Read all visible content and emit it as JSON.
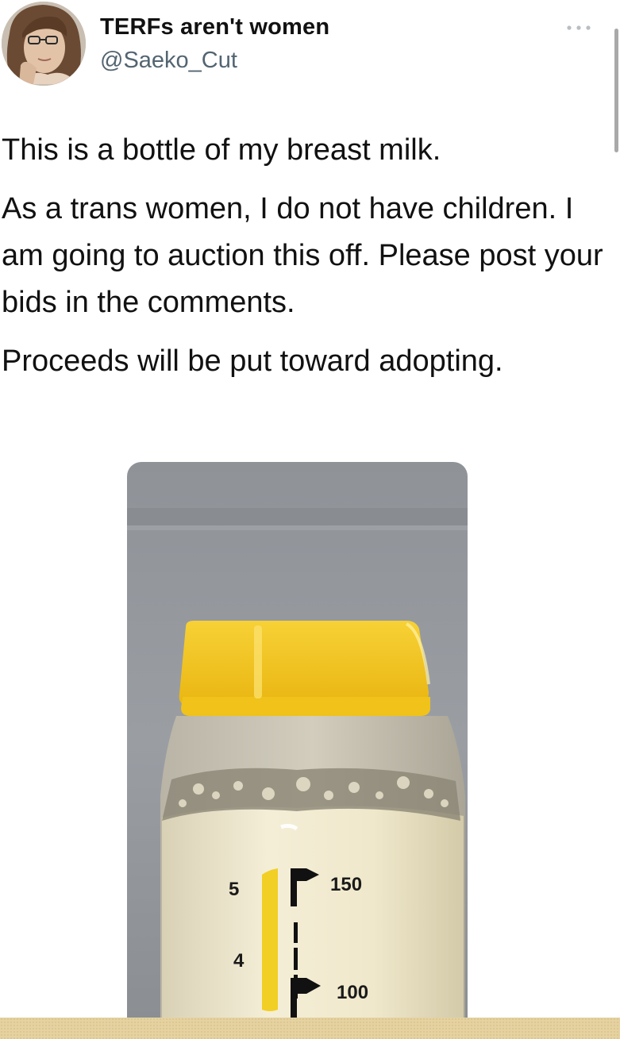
{
  "tweet": {
    "author": {
      "display_name": "TERFs aren't women",
      "handle": "@Saeko_Cut"
    },
    "menu_icon": "more-horizontal-icon",
    "text": [
      "This is a bottle of my breast milk.",
      "As a trans women, I do not have children. I am going to auction this off. Please post your bids in the comments.",
      "Proceeds will be put toward adopting."
    ],
    "media": {
      "bottle_markings": {
        "oz_left": [
          "5",
          "4"
        ],
        "ml_right": [
          "150",
          "100"
        ]
      }
    }
  },
  "colors": {
    "handle": "#536471",
    "cap": "#f2c21b",
    "milk": "#f1ead0",
    "background_gray": "#9b9fa4",
    "bottom_strip": "#e5d2a0"
  }
}
